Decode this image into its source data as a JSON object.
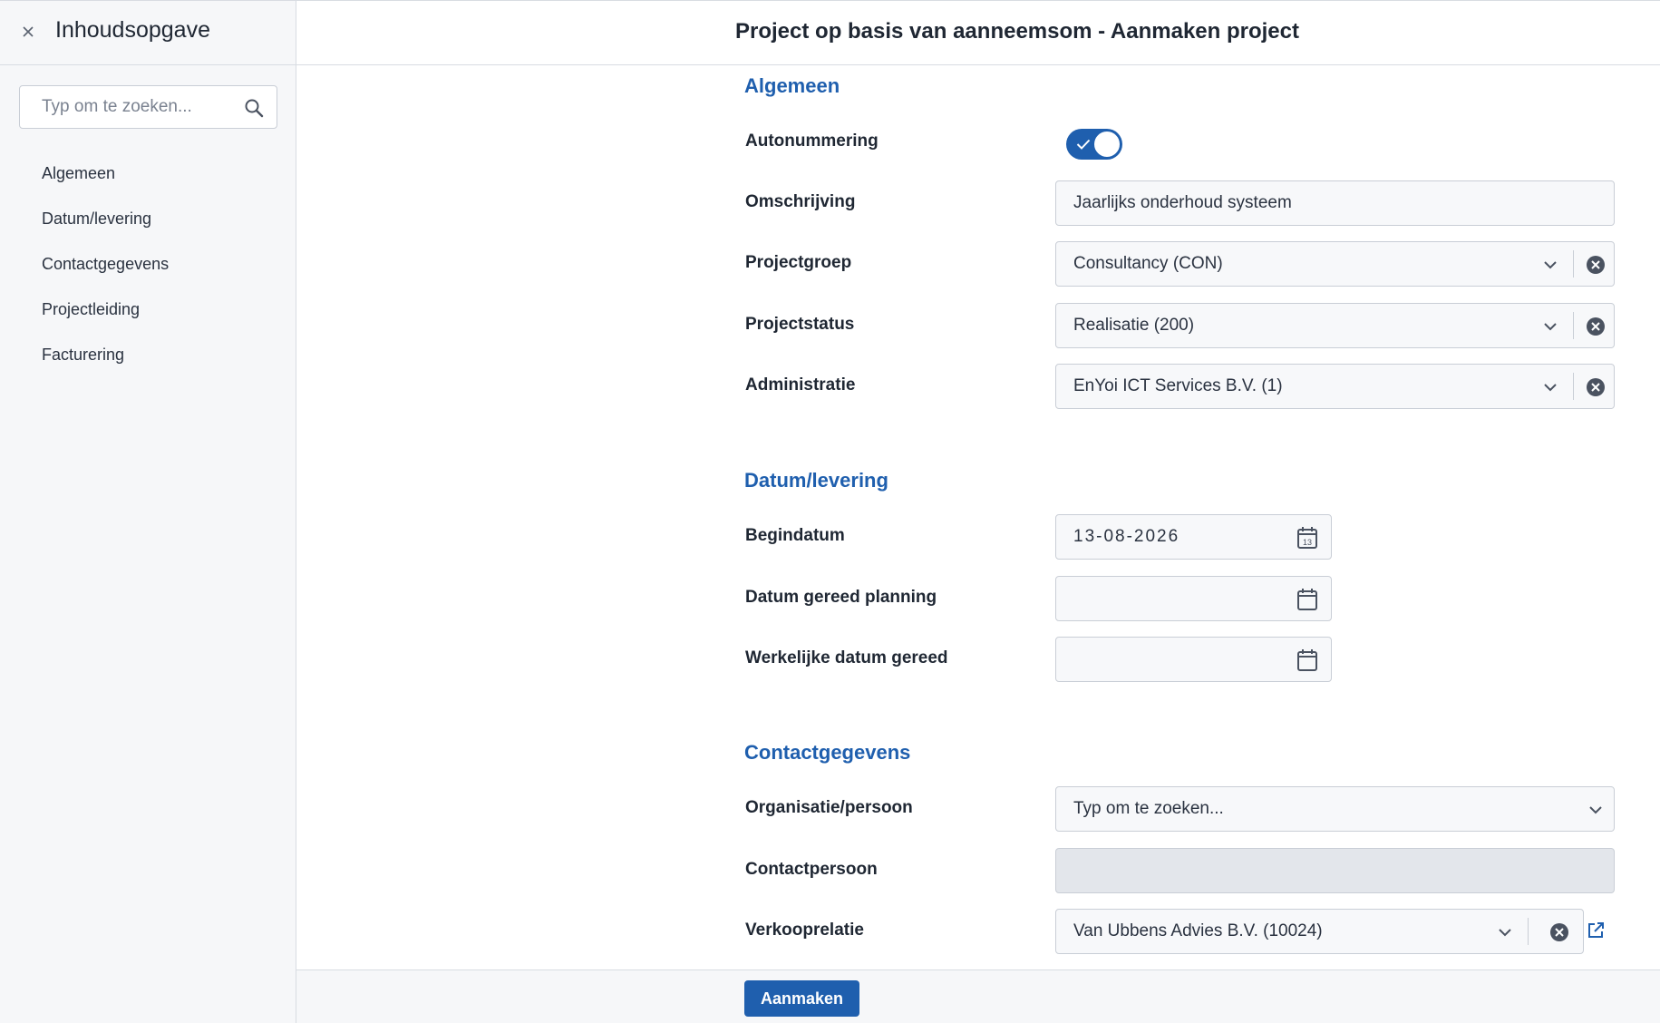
{
  "sidebar": {
    "title": "Inhoudsopgave",
    "search_placeholder": "Typ om te zoeken...",
    "items": [
      {
        "label": "Algemeen"
      },
      {
        "label": "Datum/levering"
      },
      {
        "label": "Contactgegevens"
      },
      {
        "label": "Projectleiding"
      },
      {
        "label": "Facturering"
      }
    ]
  },
  "header": {
    "title": "Project op basis van aanneemsom - Aanmaken project"
  },
  "sections": {
    "algemeen": {
      "title": "Algemeen",
      "autonummering": {
        "label": "Autonummering",
        "value": true
      },
      "omschrijving": {
        "label": "Omschrijving",
        "value": "Jaarlijks onderhoud systeem"
      },
      "projectgroep": {
        "label": "Projectgroep",
        "value": "Consultancy (CON)"
      },
      "projectstatus": {
        "label": "Projectstatus",
        "value": "Realisatie (200)"
      },
      "administratie": {
        "label": "Administratie",
        "value": "EnYoi ICT Services B.V. (1)"
      }
    },
    "datum": {
      "title": "Datum/levering",
      "begindatum": {
        "label": "Begindatum",
        "value": "13-08-2026",
        "calendar_day": "13"
      },
      "gereed_planning": {
        "label": "Datum gereed planning",
        "value": ""
      },
      "werkelijk_gereed": {
        "label": "Werkelijke datum gereed",
        "value": ""
      }
    },
    "contact": {
      "title": "Contactgegevens",
      "organisatie": {
        "label": "Organisatie/persoon",
        "placeholder": "Typ om te zoeken..."
      },
      "contactpersoon": {
        "label": "Contactpersoon",
        "value": ""
      },
      "verkooprelatie": {
        "label": "Verkooprelatie",
        "value": "Van Ubbens Advies B.V. (10024)"
      }
    }
  },
  "footer": {
    "submit_label": "Aanmaken"
  },
  "colors": {
    "accent": "#1f5fae",
    "text": "#1f2733",
    "border": "#c9ced6",
    "sidebar_bg": "#f6f7f9",
    "disabled_bg": "#e3e6eb"
  }
}
